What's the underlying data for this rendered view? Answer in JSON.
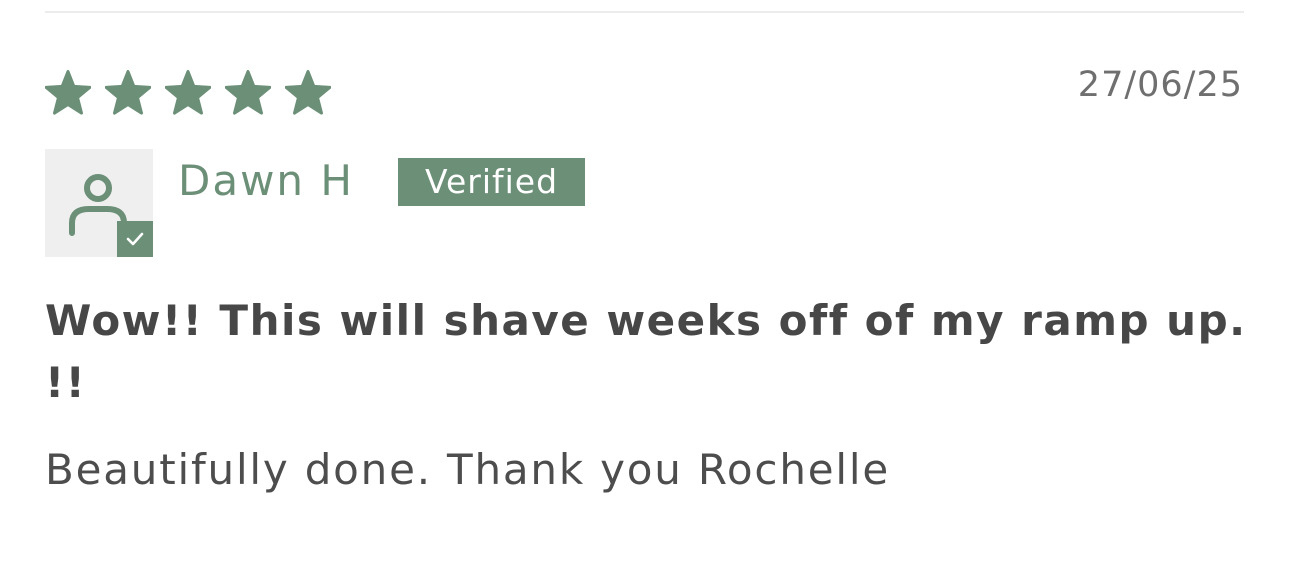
{
  "review": {
    "rating": 5,
    "rating_max": 5,
    "date": "27/06/25",
    "author": "Dawn H",
    "verified_label": "Verified",
    "title": "Wow!! This will shave weeks off of my ramp up. !!",
    "body": "Beautifully done. Thank you Rochelle"
  },
  "icons": {
    "star": "star-icon",
    "avatar": "user-icon",
    "verified_check": "check-icon"
  },
  "colors": {
    "accent": "#6b8f77",
    "title_text": "#474747",
    "body_text": "#4d4d4d",
    "date_text": "#6f6f6f",
    "avatar_bg": "#efefef"
  }
}
